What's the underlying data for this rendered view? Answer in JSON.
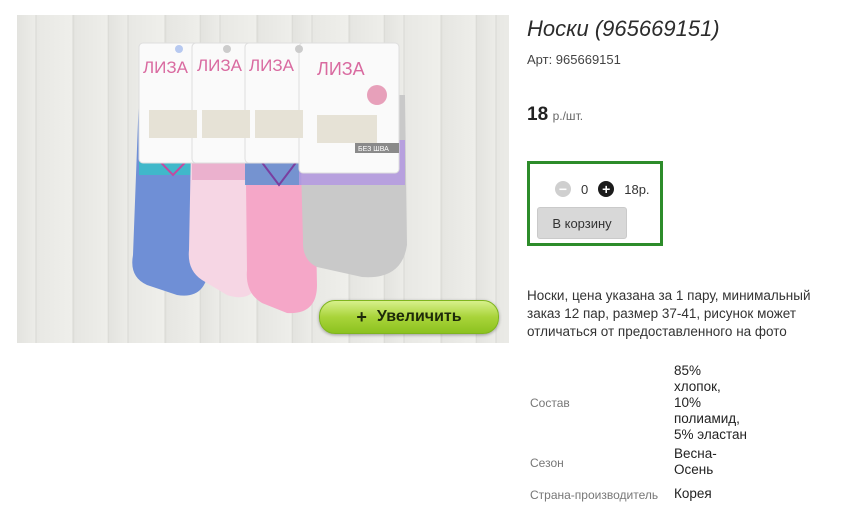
{
  "product": {
    "title": "Носки (965669151)",
    "article": "Арт: 965669151",
    "price_value": "18",
    "price_unit": "р./шт.",
    "zoom_label": "Увеличить",
    "zoom_icon": "+",
    "image_brand": "ЛИЗА",
    "image_tag_text": "БЕЗ ШВА"
  },
  "cart": {
    "quantity": "0",
    "total": "18р.",
    "minus_icon": "−",
    "plus_icon": "+",
    "add_label": "В корзину"
  },
  "description": "Носки, цена указана за 1 пару, минимальный заказ 12 пар, размер 37-41, рисунок может отличаться от предоставленного на фото",
  "attributes": [
    {
      "label": "Состав",
      "value": "85%\nхлопок,\n10%\nполиамид,\n5% эластан"
    },
    {
      "label": "Сезон",
      "value": "Весна-\nОсень"
    },
    {
      "label": "Страна-производитель",
      "value": "Корея"
    }
  ],
  "colors": {
    "accent_green": "#2d8c2a",
    "zoom_green": "#a9d43a"
  }
}
